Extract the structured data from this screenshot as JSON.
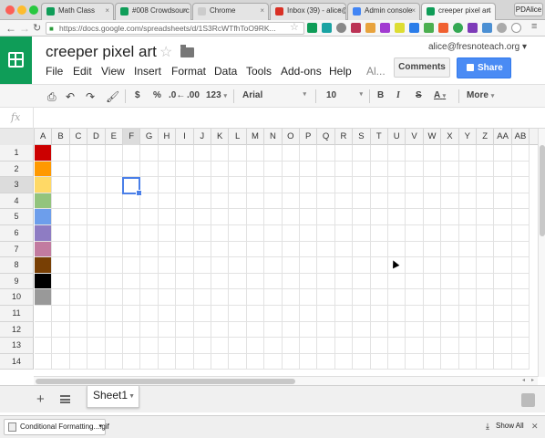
{
  "browser": {
    "tabs": [
      {
        "label": "Math Class",
        "favicon_color": "#0f9d58"
      },
      {
        "label": "#008 Crowdsourc",
        "favicon_color": "#0f9d58"
      },
      {
        "label": "Chrome",
        "favicon_color": "#cccccc"
      },
      {
        "label": "Inbox (39) - alice@",
        "favicon_color": "#d93025"
      },
      {
        "label": "Admin console",
        "favicon_color": "#4285f4"
      },
      {
        "label": "creeper pixel art",
        "favicon_color": "#0f9d58"
      }
    ],
    "profile": "PDAlice",
    "url": "https://docs.google.com/spreadsheets/d/1S3RcWTfhToO9RK..."
  },
  "doc": {
    "title": "creeper pixel art",
    "account": "alice@fresnoteach.org",
    "menu": [
      "File",
      "Edit",
      "View",
      "Insert",
      "Format",
      "Data",
      "Tools",
      "Add-ons",
      "Help",
      "Al..."
    ],
    "comments_label": "Comments",
    "share_label": "Share"
  },
  "format_toolbar": {
    "currency": "$",
    "percent": "%",
    "decrease_decimal": ".0←",
    "increase_decimal": ".00",
    "number_format": "123",
    "font": "Arial",
    "font_size": "10",
    "bold": "B",
    "italic": "I",
    "strike": "S",
    "text_color": "A",
    "more": "More"
  },
  "formula_bar": {
    "fx": "fx",
    "value": ""
  },
  "grid": {
    "columns": [
      "A",
      "B",
      "C",
      "D",
      "E",
      "F",
      "G",
      "H",
      "I",
      "J",
      "K",
      "L",
      "M",
      "N",
      "O",
      "P",
      "Q",
      "R",
      "S",
      "T",
      "U",
      "V",
      "W",
      "X",
      "Y",
      "Z",
      "AA",
      "AB"
    ],
    "rows": [
      "1",
      "2",
      "3",
      "4",
      "5",
      "6",
      "7",
      "8",
      "9",
      "10",
      "11",
      "12",
      "13",
      "14"
    ],
    "selected_column": "F",
    "selected_row": "3",
    "column_a_colors": [
      "#cc0000",
      "#ff9900",
      "#ffd966",
      "#93c47d",
      "#6d9eeb",
      "#8e7cc3",
      "#c27ba0",
      "#783f04",
      "#000000",
      "#999999"
    ]
  },
  "sheets": {
    "tabs": [
      "Sheet1"
    ]
  },
  "downloads": {
    "file": "Conditional Formatting....gif",
    "show_all": "Show All"
  }
}
